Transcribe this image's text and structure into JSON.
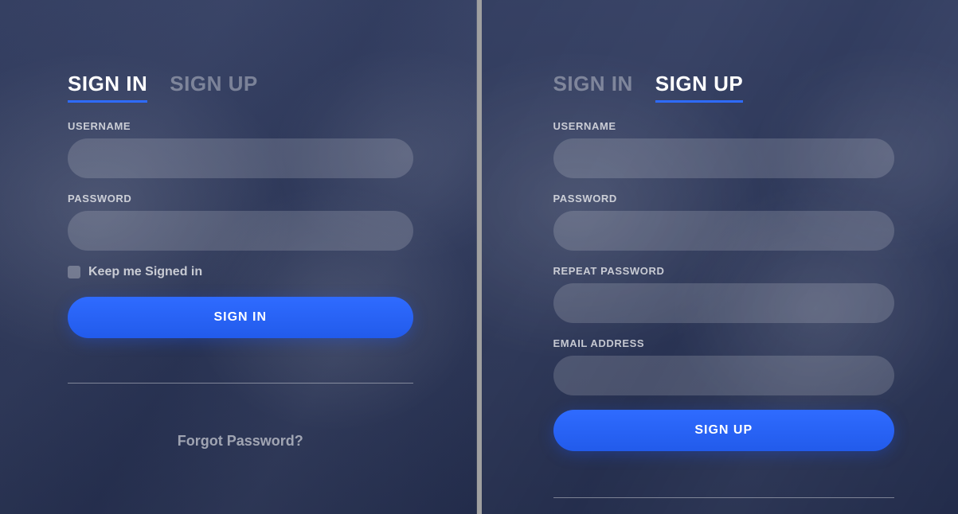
{
  "colors": {
    "accent": "#2e6bff",
    "overlay": "rgba(30,43,85,0.86)"
  },
  "left": {
    "tabs": {
      "signin": "SIGN IN",
      "signup": "SIGN UP",
      "active": "signin"
    },
    "username_label": "USERNAME",
    "username_value": "",
    "password_label": "PASSWORD",
    "password_value": "",
    "keep_signed_in_label": "Keep me Signed in",
    "keep_signed_in_checked": false,
    "submit_label": "SIGN IN",
    "forgot_label": "Forgot Password?"
  },
  "right": {
    "tabs": {
      "signin": "SIGN IN",
      "signup": "SIGN UP",
      "active": "signup"
    },
    "username_label": "USERNAME",
    "username_value": "",
    "password_label": "PASSWORD",
    "password_value": "",
    "repeat_password_label": "REPEAT PASSWORD",
    "repeat_password_value": "",
    "email_label": "EMAIL ADDRESS",
    "email_value": "",
    "submit_label": "SIGN UP"
  }
}
